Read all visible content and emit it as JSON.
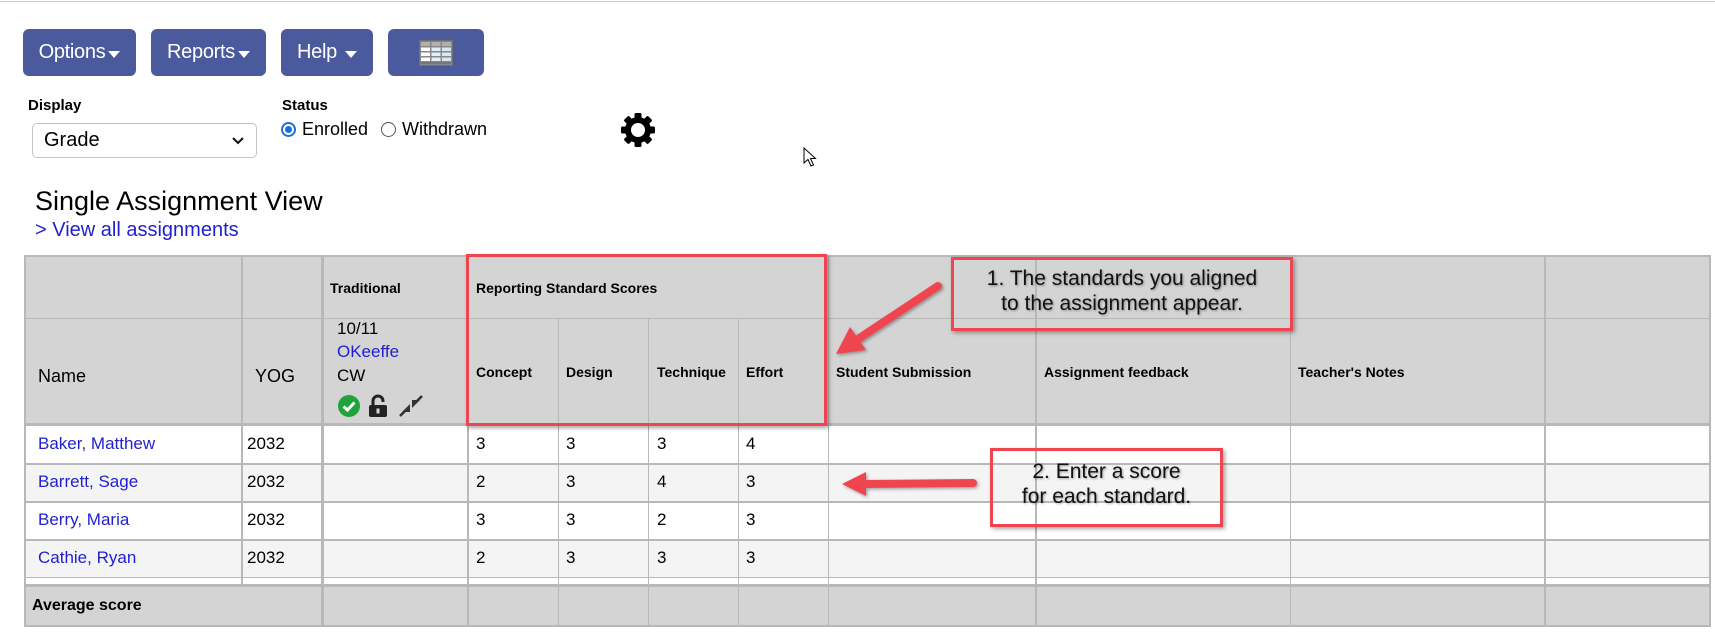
{
  "toolbar": {
    "options_label": "Options",
    "reports_label": "Reports",
    "help_label": "Help",
    "grid_icon": "spreadsheet-grid-icon"
  },
  "filters": {
    "display_label": "Display",
    "display_value": "Grade",
    "status_label": "Status",
    "status_options": [
      {
        "label": "Enrolled",
        "selected": true
      },
      {
        "label": "Withdrawn",
        "selected": false
      }
    ],
    "settings_icon": "gear-icon"
  },
  "page": {
    "title": "Single Assignment View",
    "view_all_link": "> View all assignments"
  },
  "table": {
    "group_headers": {
      "traditional": "Traditional",
      "reporting": "Reporting Standard Scores"
    },
    "columns": {
      "name": "Name",
      "yog": "YOG",
      "assignment_date": "10/11",
      "assignment_teacher": "OKeeffe",
      "assignment_code": "CW",
      "standards": [
        "Concept",
        "Design",
        "Technique",
        "Effort"
      ],
      "student_submission": "Student Submission",
      "assignment_feedback": "Assignment feedback",
      "teachers_notes": "Teacher's Notes"
    },
    "assignment_icons": [
      "check-circle-icon",
      "unlock-icon",
      "collapse-icon"
    ],
    "rows": [
      {
        "name": "Baker, Matthew",
        "yog": "2032",
        "traditional": "",
        "scores": [
          "3",
          "3",
          "3",
          "4"
        ]
      },
      {
        "name": "Barrett, Sage",
        "yog": "2032",
        "traditional": "",
        "scores": [
          "2",
          "3",
          "4",
          "3"
        ]
      },
      {
        "name": "Berry, Maria",
        "yog": "2032",
        "traditional": "",
        "scores": [
          "3",
          "3",
          "2",
          "3"
        ]
      },
      {
        "name": "Cathie, Ryan",
        "yog": "2032",
        "traditional": "",
        "scores": [
          "2",
          "3",
          "3",
          "3"
        ]
      }
    ],
    "footer_label": "Average score"
  },
  "annotations": {
    "callout_1": [
      "1. The standards you aligned",
      "to the assignment appear."
    ],
    "callout_2": [
      "2. Enter a score",
      "for each standard."
    ],
    "accent_color": "#ee4550"
  },
  "colors": {
    "button_bg": "#4b5a9c",
    "header_bg": "#d4d4d4",
    "link": "#1f1fd0",
    "radio_selected": "#1a6fe0"
  }
}
